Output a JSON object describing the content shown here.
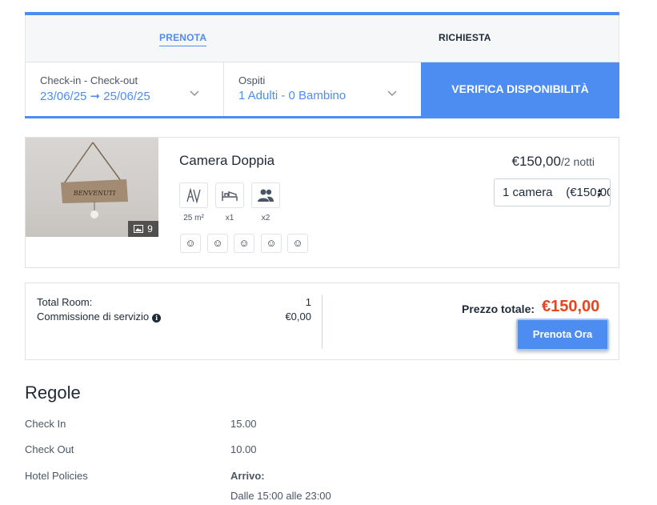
{
  "tabs": {
    "book": "PRENOTA",
    "request": "RICHIESTA"
  },
  "search": {
    "dates_label": "Check-in - Check-out",
    "dates_value": "23/06/25 ➞ 25/06/25",
    "guests_label": "Ospiti",
    "guests_value": "1 Adulti - 0 Bambino",
    "verify_button": "VERIFICA DISPONIBILITÀ"
  },
  "room": {
    "name": "Camera Doppia",
    "photo_count": "9",
    "price": "€150,00",
    "price_period": "/2 notti",
    "select_value": "1 camera    (€150,00)",
    "amenities": [
      {
        "icon": "area-icon",
        "label": "25 m²"
      },
      {
        "icon": "bed-icon",
        "label": "x1"
      },
      {
        "icon": "guests-icon",
        "label": "x2"
      }
    ],
    "extra_icons": [
      "☺",
      "☺",
      "☺",
      "☺",
      "☺"
    ]
  },
  "summary": {
    "total_room_label": "Total Room:",
    "total_room_value": "1",
    "fee_label": "Commissione di servizio",
    "fee_value": "€0,00",
    "total_label": "Prezzo totale:",
    "total_amount": "€150,00",
    "book_button": "Prenota Ora"
  },
  "rules": {
    "title": "Regole",
    "check_in_label": "Check In",
    "check_in_value": "15.00",
    "check_out_label": "Check Out",
    "check_out_value": "10.00",
    "policies_label": "Hotel Policies",
    "policies_heading": "Arrivo:",
    "policies_text": "Dalle 15:00 alle 23:00"
  },
  "colors": {
    "accent": "#4d8df2",
    "price_total": "#e8451e",
    "text": "#1e2a38"
  }
}
